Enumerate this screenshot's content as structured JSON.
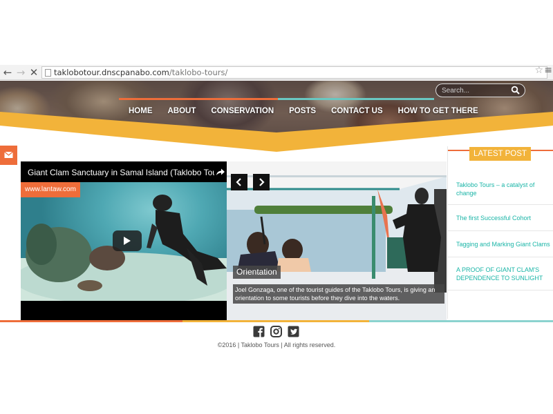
{
  "browser": {
    "back_icon": "arrow-left-icon",
    "forward_icon": "arrow-right-icon",
    "stop_icon": "close-icon",
    "url_host": "taklobotour.dnscpanabo.com",
    "url_path": "/taklobo-tours/",
    "bookmark_icon": "star-icon",
    "menu_icon": "menu-icon"
  },
  "header": {
    "search": {
      "placeholder": "Search..."
    },
    "nav": [
      "HOME",
      "ABOUT",
      "CONSERVATION",
      "POSTS",
      "CONTACT US",
      "HOW TO GET THERE"
    ]
  },
  "slider": {
    "video": {
      "title": "Giant Clam Sanctuary in Samal Island (Taklobo Tour...",
      "source": "www.lantaw.com"
    },
    "slide": {
      "title": "Orientation",
      "caption": "Joel Gonzaga, one of the tourist guides of the Taklobo Tours, is giving an orientation to some tourists before they dive into the waters."
    }
  },
  "sidebar": {
    "heading": "LATEST POST",
    "posts": [
      "Taklobo Tours – a catalyst of change",
      "The first Successful Cohort",
      "Tagging and Marking Giant Clams",
      "A PROOF OF GIANT CLAM'S DEPENDENCE TO SUNLIGHT"
    ]
  },
  "footer": {
    "copyright": "©2016 | Taklobo Tours | All rights reserved."
  },
  "colors": {
    "orange": "#ee6d3a",
    "yellow": "#f2b33a",
    "teal": "#69c8c2",
    "link": "#1ab5a7"
  }
}
